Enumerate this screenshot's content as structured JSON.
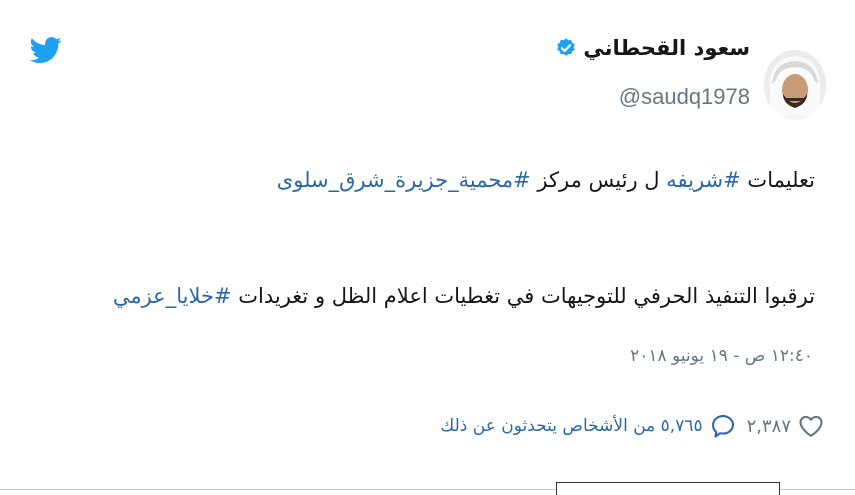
{
  "tweet": {
    "display_name": "سعود القحطاني",
    "handle": "@saudq1978",
    "line1_prefix": "تعليمات ",
    "line1_hashtag1": "#شريفه",
    "line1_middle": " ل رئيس مركز ",
    "line1_hashtag2": "#محمية_جزيرة_شرق_سلوى",
    "line2_prefix": "ترقبوا التنفيذ الحرفي للتوجيهات في تغطيات اعلام الظل و تغريدات ",
    "line2_hashtag": "#خلايا_عزمي",
    "timestamp": "١٢:٤٠ ص - ١٩ يونيو ٢٠١٨",
    "likes_count": "٢,٣٨٧",
    "people_talking": "٥,٧٦٥ من الأشخاص يتحدثون عن ذلك"
  },
  "colors": {
    "twitter_blue": "#1da1f2",
    "link_blue": "#2a69a8",
    "secondary_gray": "#657786",
    "text": "#14171a"
  },
  "icons": {
    "logo": "twitter-bird-icon",
    "verified": "verified-badge-icon",
    "like": "heart-icon",
    "reply": "speech-bubble-icon"
  }
}
